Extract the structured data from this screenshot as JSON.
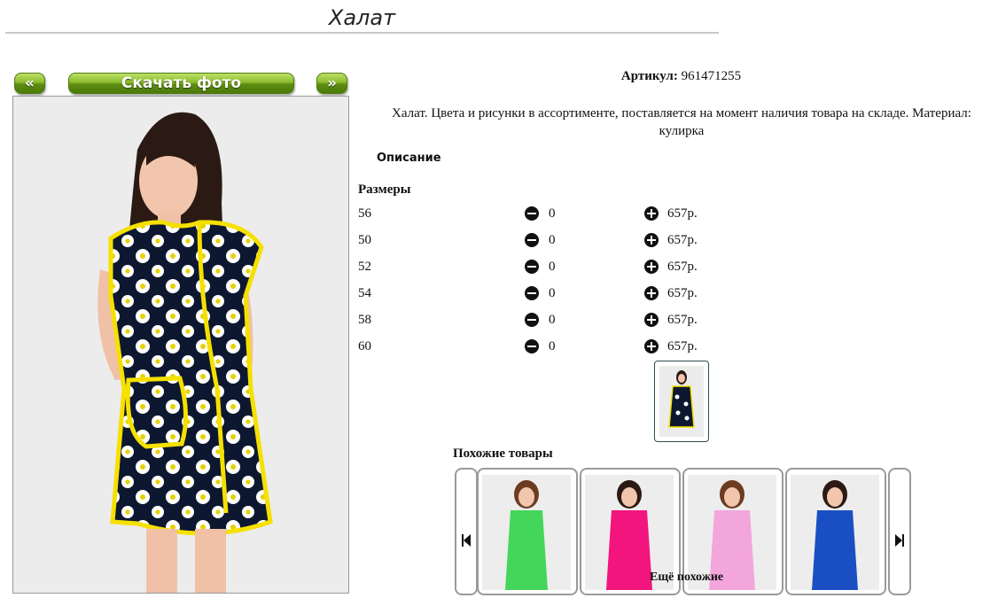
{
  "page": {
    "title": "Халат"
  },
  "gallery": {
    "prev_label": "«",
    "next_label": "»",
    "download_label": "Скачать фото"
  },
  "product": {
    "sku_label": "Артикул:",
    "sku_value": "961471255",
    "description": "Халат. Цвета и рисунки в ассортименте, поставляется на момент наличия товара на складе. Материал: кулирка",
    "description_tab": "Описание",
    "sizes_title": "Размеры",
    "sizes": [
      {
        "size": "56",
        "qty": "0",
        "price": "657р."
      },
      {
        "size": "50",
        "qty": "0",
        "price": "657р."
      },
      {
        "size": "52",
        "qty": "0",
        "price": "657р."
      },
      {
        "size": "54",
        "qty": "0",
        "price": "657р."
      },
      {
        "size": "58",
        "qty": "0",
        "price": "657р."
      },
      {
        "size": "60",
        "qty": "0",
        "price": "657р."
      }
    ]
  },
  "similar": {
    "title": "Похожие товары",
    "more_label": "Ещё похожие",
    "items": [
      {
        "color": "#44d65a"
      },
      {
        "color": "#f2157d"
      },
      {
        "color": "#f3a6dc"
      },
      {
        "color": "#1a4fc4"
      }
    ]
  },
  "colors": {
    "button_green": "#6fa21b",
    "dress_dark": "#0d1830",
    "dress_trim": "#f5e000"
  }
}
